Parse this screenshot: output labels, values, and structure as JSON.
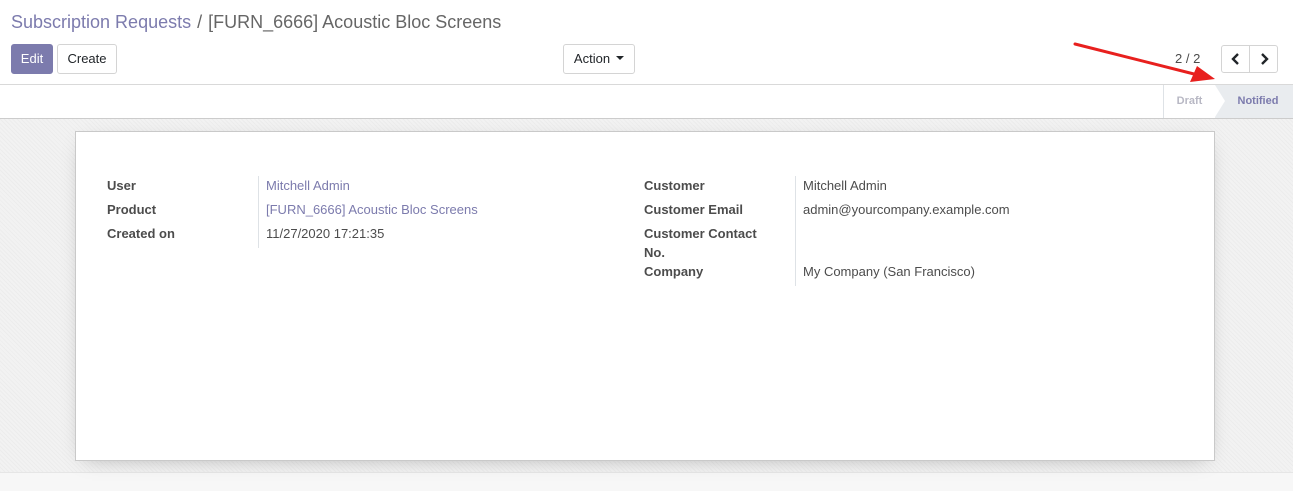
{
  "breadcrumb": {
    "parent": "Subscription Requests",
    "separator": "/",
    "current": "[FURN_6666] Acoustic Bloc Screens"
  },
  "toolbar": {
    "edit_label": "Edit",
    "create_label": "Create",
    "action_label": "Action"
  },
  "pager": {
    "value": "2 / 2",
    "prev_icon": "chevron-left-icon",
    "next_icon": "chevron-right-icon"
  },
  "statusbar": {
    "draft_label": "Draft",
    "notified_label": "Notified",
    "active": "Notified"
  },
  "form": {
    "left": {
      "user_label": "User",
      "user_value": "Mitchell Admin",
      "product_label": "Product",
      "product_value": "[FURN_6666] Acoustic Bloc Screens",
      "created_label": "Created on",
      "created_value": "11/27/2020 17:21:35"
    },
    "right": {
      "customer_label": "Customer",
      "customer_value": "Mitchell Admin",
      "email_label": "Customer Email",
      "email_value": "admin@yourcompany.example.com",
      "contact_label_line1": "Customer Contact",
      "contact_label_line2": "No.",
      "contact_value": "",
      "company_label": "Company",
      "company_value": "My Company (San Francisco)"
    }
  },
  "colors": {
    "brand": "#7c7bad",
    "annotation_arrow": "#e8201e",
    "text": "#4c4c4c"
  }
}
